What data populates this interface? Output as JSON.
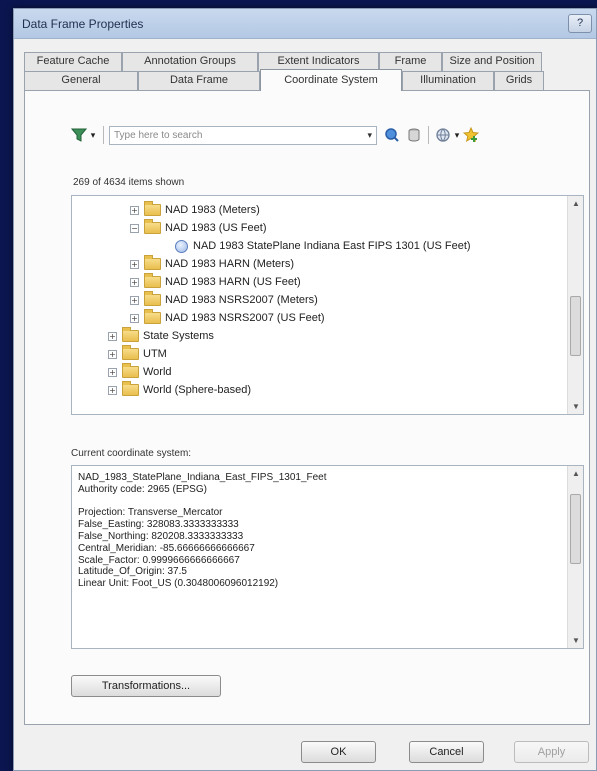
{
  "window": {
    "title": "Data Frame Properties",
    "help_label": "?"
  },
  "tabs": {
    "back_row": [
      "Feature Cache",
      "Annotation Groups",
      "Extent Indicators",
      "Frame",
      "Size and Position"
    ],
    "front_row": [
      "General",
      "Data Frame",
      "Coordinate System",
      "Illumination",
      "Grids"
    ],
    "active": "Coordinate System"
  },
  "toolbar": {
    "search_placeholder": "Type here to search",
    "icons": [
      "filter-icon",
      "search-icon",
      "database-icon",
      "globe-icon",
      "add-favorite-icon"
    ]
  },
  "tree": {
    "count_text": "269 of 4634 items shown",
    "items": [
      {
        "label": "NAD 1983 (Meters)",
        "level": 2,
        "type": "folder",
        "expander": "+"
      },
      {
        "label": "NAD 1983 (US Feet)",
        "level": 2,
        "type": "folder",
        "expander": "−"
      },
      {
        "label": "NAD 1983 StatePlane Indiana East FIPS 1301 (US Feet)",
        "level": 3,
        "type": "crs",
        "expander": ""
      },
      {
        "label": "NAD 1983 HARN (Meters)",
        "level": 2,
        "type": "folder",
        "expander": "+"
      },
      {
        "label": "NAD 1983 HARN (US Feet)",
        "level": 2,
        "type": "folder",
        "expander": "+"
      },
      {
        "label": "NAD 1983 NSRS2007 (Meters)",
        "level": 2,
        "type": "folder",
        "expander": "+"
      },
      {
        "label": "NAD 1983 NSRS2007 (US Feet)",
        "level": 2,
        "type": "folder",
        "expander": "+"
      },
      {
        "label": "State Systems",
        "level": 1,
        "type": "folder",
        "expander": "+"
      },
      {
        "label": "UTM",
        "level": 1,
        "type": "folder",
        "expander": "+"
      },
      {
        "label": "World",
        "level": 1,
        "type": "folder",
        "expander": "+"
      },
      {
        "label": "World (Sphere-based)",
        "level": 1,
        "type": "folder",
        "expander": "+"
      }
    ]
  },
  "current": {
    "label": "Current coordinate system:",
    "lines": [
      "NAD_1983_StatePlane_Indiana_East_FIPS_1301_Feet",
      "Authority code: 2965 (EPSG)",
      "",
      "Projection: Transverse_Mercator",
      "False_Easting: 328083.3333333333",
      "False_Northing: 820208.3333333333",
      "Central_Meridian: -85.66666666666667",
      "Scale_Factor: 0.9999666666666667",
      "Latitude_Of_Origin: 37.5",
      "Linear Unit: Foot_US (0.3048006096012192)"
    ]
  },
  "buttons": {
    "transformations": "Transformations...",
    "ok": "OK",
    "cancel": "Cancel",
    "apply": "Apply"
  }
}
